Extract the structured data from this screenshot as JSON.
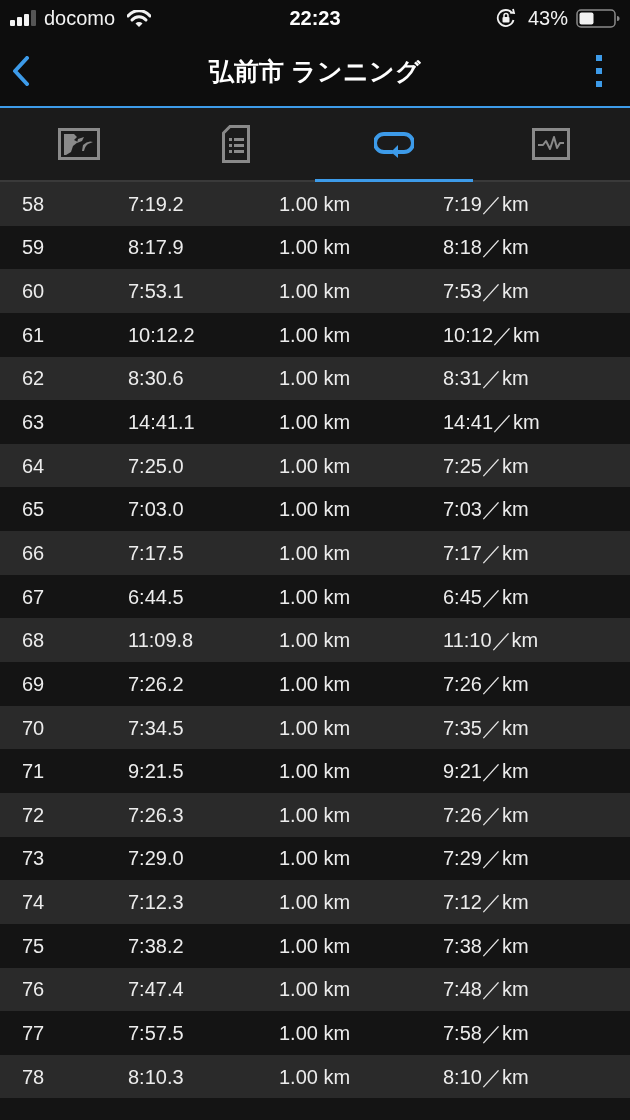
{
  "status_bar": {
    "carrier": "docomo",
    "time": "22:23",
    "battery": "43%"
  },
  "header": {
    "title": "弘前市 ランニング"
  },
  "tabs": [
    {
      "kind": "map",
      "selected": false
    },
    {
      "kind": "document",
      "selected": false
    },
    {
      "kind": "laps",
      "selected": true
    },
    {
      "kind": "graph",
      "selected": false
    }
  ],
  "laps": [
    {
      "lap": "58",
      "time": "7:19.2",
      "distance": "1.00 km",
      "pace": "7:19／km"
    },
    {
      "lap": "59",
      "time": "8:17.9",
      "distance": "1.00 km",
      "pace": "8:18／km"
    },
    {
      "lap": "60",
      "time": "7:53.1",
      "distance": "1.00 km",
      "pace": "7:53／km"
    },
    {
      "lap": "61",
      "time": "10:12.2",
      "distance": "1.00 km",
      "pace": "10:12／km"
    },
    {
      "lap": "62",
      "time": "8:30.6",
      "distance": "1.00 km",
      "pace": "8:31／km"
    },
    {
      "lap": "63",
      "time": "14:41.1",
      "distance": "1.00 km",
      "pace": "14:41／km"
    },
    {
      "lap": "64",
      "time": "7:25.0",
      "distance": "1.00 km",
      "pace": "7:25／km"
    },
    {
      "lap": "65",
      "time": "7:03.0",
      "distance": "1.00 km",
      "pace": "7:03／km"
    },
    {
      "lap": "66",
      "time": "7:17.5",
      "distance": "1.00 km",
      "pace": "7:17／km"
    },
    {
      "lap": "67",
      "time": "6:44.5",
      "distance": "1.00 km",
      "pace": "6:45／km"
    },
    {
      "lap": "68",
      "time": "11:09.8",
      "distance": "1.00 km",
      "pace": "11:10／km"
    },
    {
      "lap": "69",
      "time": "7:26.2",
      "distance": "1.00 km",
      "pace": "7:26／km"
    },
    {
      "lap": "70",
      "time": "7:34.5",
      "distance": "1.00 km",
      "pace": "7:35／km"
    },
    {
      "lap": "71",
      "time": "9:21.5",
      "distance": "1.00 km",
      "pace": "9:21／km"
    },
    {
      "lap": "72",
      "time": "7:26.3",
      "distance": "1.00 km",
      "pace": "7:26／km"
    },
    {
      "lap": "73",
      "time": "7:29.0",
      "distance": "1.00 km",
      "pace": "7:29／km"
    },
    {
      "lap": "74",
      "time": "7:12.3",
      "distance": "1.00 km",
      "pace": "7:12／km"
    },
    {
      "lap": "75",
      "time": "7:38.2",
      "distance": "1.00 km",
      "pace": "7:38／km"
    },
    {
      "lap": "76",
      "time": "7:47.4",
      "distance": "1.00 km",
      "pace": "7:48／km"
    },
    {
      "lap": "77",
      "time": "7:57.5",
      "distance": "1.00 km",
      "pace": "7:58／km"
    },
    {
      "lap": "78",
      "time": "8:10.3",
      "distance": "1.00 km",
      "pace": "8:10／km"
    }
  ]
}
